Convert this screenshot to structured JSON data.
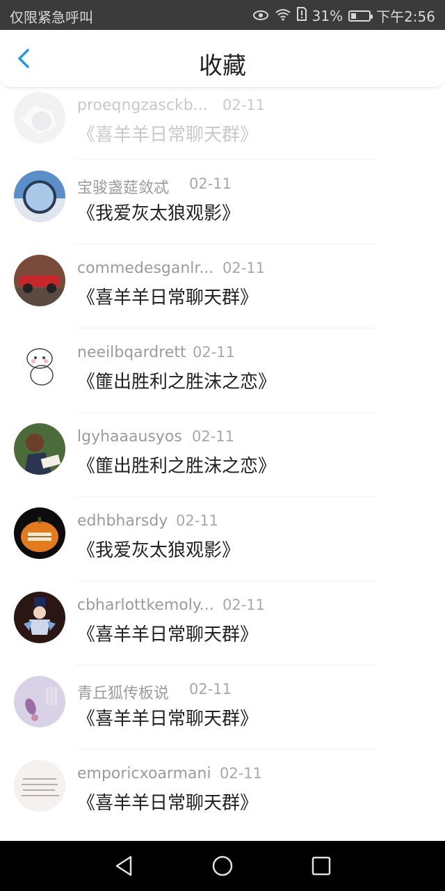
{
  "status_bar": {
    "left_text": "仅限紧急呼叫",
    "battery_text": "31%",
    "battery_level": 0.31,
    "time": "下午2:56",
    "icons": [
      "eye-icon",
      "wifi-icon",
      "sim-alert-icon",
      "battery-icon"
    ]
  },
  "header": {
    "title": "收藏",
    "back_icon": "chevron-left-icon",
    "accent": "#1e9be8"
  },
  "favorites": [
    {
      "name": "proeqngzasckb...",
      "date": "02-11",
      "group": "《喜羊羊日常聊天群》"
    },
    {
      "name": "宝骏盏莚敛忒",
      "date": "02-11",
      "group": "《我爱灰太狼观影》"
    },
    {
      "name": "commedesganlr...",
      "date": "02-11",
      "group": "《喜羊羊日常聊天群》"
    },
    {
      "name": "neeilbqardrett",
      "date": "02-11",
      "group": "《篚出胜利之胜沫之恋》"
    },
    {
      "name": "lgyhaaausyos",
      "date": "02-11",
      "group": "《篚出胜利之胜沫之恋》"
    },
    {
      "name": "edhbharsdy",
      "date": "02-11",
      "group": "《我爱灰太狼观影》"
    },
    {
      "name": "cbharlottkemoly...",
      "date": "02-11",
      "group": "《喜羊羊日常聊天群》"
    },
    {
      "name": "青丘狐传板说",
      "date": "02-11",
      "group": "《喜羊羊日常聊天群》"
    },
    {
      "name": "emporicxoarmani",
      "date": "02-11",
      "group": "《喜羊羊日常聊天群》"
    }
  ],
  "nav_bar": {
    "icons": [
      "back-triangle-icon",
      "home-circle-icon",
      "recents-square-icon"
    ]
  }
}
